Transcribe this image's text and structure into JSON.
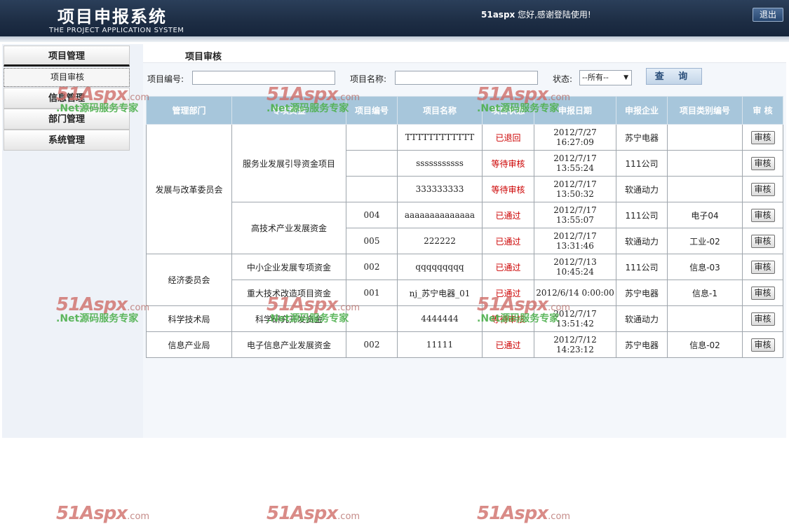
{
  "header": {
    "title": "项目申报系统",
    "subtitle": "THE PROJECT APPLICATION SYSTEM",
    "welcome_user": "51aspx",
    "welcome_text": " 您好,感谢登陆使用!",
    "logout_label": "退出"
  },
  "sidebar": {
    "menus": [
      {
        "label": "项目管理"
      },
      {
        "label": "信息管理"
      },
      {
        "label": "部门管理"
      },
      {
        "label": "系统管理"
      }
    ],
    "submenu": {
      "label": "项目审核"
    }
  },
  "main": {
    "title": "项目审核",
    "search": {
      "code_label": "项目编号:",
      "code_value": "",
      "name_label": "项目名称:",
      "name_value": "",
      "status_label": "状态:",
      "status_selected": "--所有--",
      "query_label": "查 询"
    }
  },
  "table": {
    "headers": [
      "管理部门",
      "专项资金",
      "项目编号",
      "项目名称",
      "项目状态",
      "申报日期",
      "申报企业",
      "项目类别编号",
      "审 核"
    ],
    "departments": [
      "发展与改革委员会",
      "经济委员会",
      "科学技术局",
      "信息产业局"
    ],
    "funds": [
      "服务业发展引导资金项目",
      "高技术产业发展资金",
      "中小企业发展专项资金",
      "重大技术改造项目资金",
      "科学研究开发资金",
      "电子信息产业发展资金"
    ],
    "rows": [
      {
        "code": "",
        "name": "TTTTTTTTTTTT",
        "status": "已退回",
        "date": "2012/7/27 16:27:09",
        "company": "苏宁电器",
        "category": "",
        "action": "审核"
      },
      {
        "code": "",
        "name": "sssssssssss",
        "status": "等待审核",
        "date": "2012/7/17 13:55:24",
        "company": "111公司",
        "category": "",
        "action": "审核"
      },
      {
        "code": "",
        "name": "333333333",
        "status": "等待审核",
        "date": "2012/7/17 13:50:32",
        "company": "软通动力",
        "category": "",
        "action": "审核"
      },
      {
        "code": "004",
        "name": "aaaaaaaaaaaaaa",
        "status": "已通过",
        "date": "2012/7/17 13:55:07",
        "company": "111公司",
        "category": "电子04",
        "action": "审核"
      },
      {
        "code": "005",
        "name": "222222",
        "status": "已通过",
        "date": "2012/7/17 13:31:46",
        "company": "软通动力",
        "category": "工业-02",
        "action": "审核"
      },
      {
        "code": "002",
        "name": "qqqqqqqqq",
        "status": "已通过",
        "date": "2012/7/13 10:45:24",
        "company": "111公司",
        "category": "信息-03",
        "action": "审核"
      },
      {
        "code": "001",
        "name": "nj_苏宁电器_01",
        "status": "已通过",
        "date": "2012/6/14 0:00:00",
        "company": "苏宁电器",
        "category": "信息-1",
        "action": "审核"
      },
      {
        "code": "",
        "name": "4444444",
        "status": "等待审核",
        "date": "2012/7/17 13:51:42",
        "company": "软通动力",
        "category": "",
        "action": "审核"
      },
      {
        "code": "002",
        "name": "11111",
        "status": "已通过",
        "date": "2012/7/12 14:23:12",
        "company": "苏宁电器",
        "category": "信息-02",
        "action": "审核"
      }
    ]
  },
  "watermark": {
    "logo": "51Aspx",
    "logo_suffix": ".com",
    "tagline": ".Net源码服务专家"
  }
}
